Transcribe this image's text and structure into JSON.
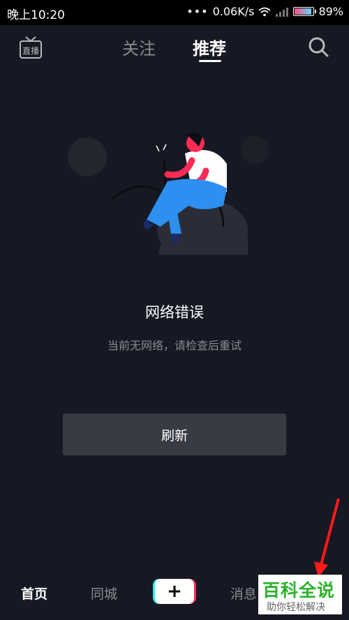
{
  "status_bar": {
    "time": "晚上10:20",
    "dots": "•••",
    "network_speed": "0.06K/s",
    "battery": "89%",
    "battery_level": 0.89
  },
  "top_nav": {
    "live_label": "直播",
    "tabs": [
      {
        "label": "关注",
        "active": false
      },
      {
        "label": "推荐",
        "active": true
      }
    ]
  },
  "error": {
    "title": "网络错误",
    "description": "当前无网络，请检查后重试",
    "refresh_label": "刷新"
  },
  "bottom_nav": {
    "items": [
      {
        "label": "首页",
        "active": true
      },
      {
        "label": "同城",
        "active": false
      },
      {
        "label": "消息",
        "active": false
      }
    ],
    "plus": "+"
  },
  "watermark": {
    "main": "百科全说",
    "sub": "助你轻松解决"
  },
  "colors": {
    "background": "#161823",
    "button": "#393b44",
    "accent_cyan": "#25f4ee",
    "accent_red": "#fe2c55",
    "illustration_pink": "#fe2c55",
    "illustration_blue": "#2d8ff0"
  }
}
